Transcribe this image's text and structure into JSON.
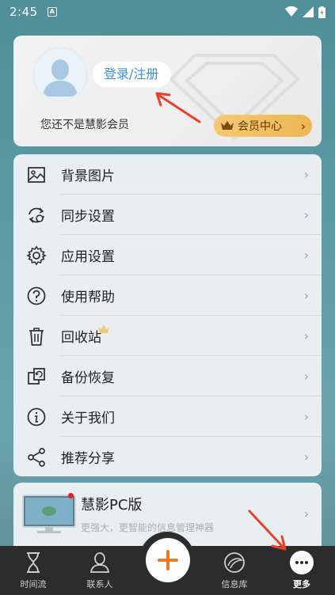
{
  "status_bar": {
    "time": "2:45",
    "notification_badge": "A"
  },
  "profile": {
    "login_label": "登录/注册",
    "not_member_text": "您还不是慧影会员",
    "vip_label": "会员中心"
  },
  "menu": {
    "items": [
      {
        "label": "背景图片",
        "icon": "image-icon"
      },
      {
        "label": "同步设置",
        "icon": "sync-settings-icon"
      },
      {
        "label": "应用设置",
        "icon": "gear-icon"
      },
      {
        "label": "使用帮助",
        "icon": "help-icon"
      },
      {
        "label": "回收站",
        "icon": "trash-icon"
      },
      {
        "label": "备份恢复",
        "icon": "backup-icon"
      },
      {
        "label": "关于我们",
        "icon": "info-icon"
      },
      {
        "label": "推荐分享",
        "icon": "share-icon"
      }
    ]
  },
  "promo": {
    "title": "慧影PC版",
    "subtitle": "更强大，更智能的信息管理神器"
  },
  "bottom_nav": {
    "items": [
      {
        "label": "时间流",
        "icon": "hourglass-icon"
      },
      {
        "label": "联系人",
        "icon": "contact-icon"
      },
      {
        "label": "信息库",
        "icon": "library-icon"
      },
      {
        "label": "更多",
        "icon": "more-icon"
      }
    ]
  },
  "colors": {
    "accent_blue": "#3a8fd6",
    "vip_gold": "#f0bb5c",
    "plus_orange": "#f07a1f",
    "arrow_red": "#e8412c",
    "nav_bg": "#2c2c2c"
  }
}
